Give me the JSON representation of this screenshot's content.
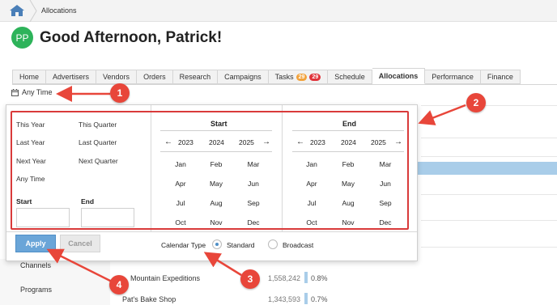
{
  "breadcrumb": {
    "current": "Allocations"
  },
  "greeting": {
    "avatar_initials": "PP",
    "text": "Good Afternoon, Patrick!"
  },
  "tabs": [
    {
      "label": "Home"
    },
    {
      "label": "Advertisers"
    },
    {
      "label": "Vendors"
    },
    {
      "label": "Orders"
    },
    {
      "label": "Research"
    },
    {
      "label": "Campaigns"
    },
    {
      "label": "Tasks",
      "badges": [
        "29",
        "29"
      ]
    },
    {
      "label": "Schedule"
    },
    {
      "label": "Allocations",
      "active": true
    },
    {
      "label": "Performance"
    },
    {
      "label": "Finance"
    }
  ],
  "date_trigger": {
    "label": "Any Time"
  },
  "date_picker": {
    "quick_options": [
      "This Year",
      "This Quarter",
      "Last Year",
      "Last Quarter",
      "Next Year",
      "Next Quarter",
      "Any Time"
    ],
    "start_label": "Start",
    "end_label": "End",
    "calendars": [
      {
        "title": "Start",
        "years": [
          "2023",
          "2024",
          "2025"
        ],
        "months": [
          "Jan",
          "Feb",
          "Mar",
          "Apr",
          "May",
          "Jun",
          "Jul",
          "Aug",
          "Sep",
          "Oct",
          "Nov",
          "Dec"
        ]
      },
      {
        "title": "End",
        "years": [
          "2023",
          "2024",
          "2025"
        ],
        "months": [
          "Jan",
          "Feb",
          "Mar",
          "Apr",
          "May",
          "Jun",
          "Jul",
          "Aug",
          "Sep",
          "Oct",
          "Nov",
          "Dec"
        ]
      }
    ],
    "apply_label": "Apply",
    "cancel_label": "Cancel",
    "calendar_type_label": "Calendar Type",
    "calendar_types": [
      {
        "label": "Standard",
        "selected": true
      },
      {
        "label": "Broadcast",
        "selected": false
      }
    ]
  },
  "sidebar": {
    "items": [
      "Channels",
      "Programs"
    ]
  },
  "list": [
    {
      "name": "Mountain Expeditions",
      "value": "1,558,242",
      "pct": "0.8%"
    },
    {
      "name": "Pat's Bake Shop",
      "value": "1,343,593",
      "pct": "0.7%"
    }
  ],
  "annotations": [
    "1",
    "2",
    "3",
    "4"
  ],
  "colors": {
    "accent_blue": "#6aa5d8",
    "annotation_red": "#e8463a",
    "avatar_green": "#2db35a"
  }
}
